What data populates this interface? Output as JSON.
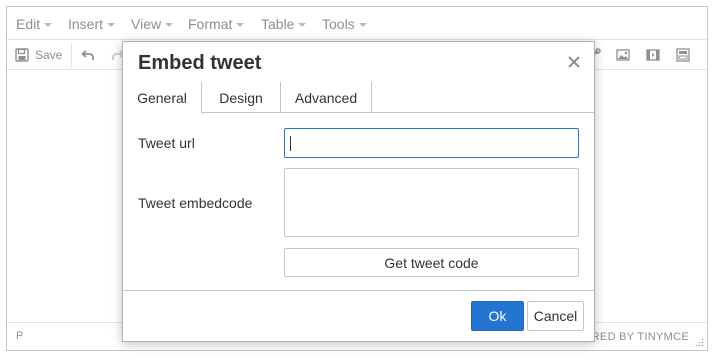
{
  "menubar": {
    "items": [
      {
        "label": "Edit"
      },
      {
        "label": "Insert"
      },
      {
        "label": "View"
      },
      {
        "label": "Format"
      },
      {
        "label": "Table"
      },
      {
        "label": "Tools"
      }
    ]
  },
  "toolbar": {
    "save_label": "Save",
    "icons": [
      "save-icon",
      "undo-icon",
      "redo-icon",
      "link-icon",
      "image-icon",
      "media-icon",
      "template-icon"
    ]
  },
  "statusbar": {
    "path": "P",
    "powered_by": "ERED BY TINYMCE"
  },
  "dialog": {
    "title": "Embed tweet",
    "tabs": [
      {
        "label": "General",
        "active": true
      },
      {
        "label": "Design",
        "active": false
      },
      {
        "label": "Advanced",
        "active": false
      }
    ],
    "fields": {
      "tweet_url_label": "Tweet url",
      "tweet_url_value": "",
      "embedcode_label": "Tweet embedcode",
      "embedcode_value": ""
    },
    "get_code_button": "Get tweet code",
    "ok_label": "Ok",
    "cancel_label": "Cancel"
  },
  "colors": {
    "accent": "#2276d2",
    "border": "#c5c5c5",
    "muted_text": "#8f8f8f"
  }
}
